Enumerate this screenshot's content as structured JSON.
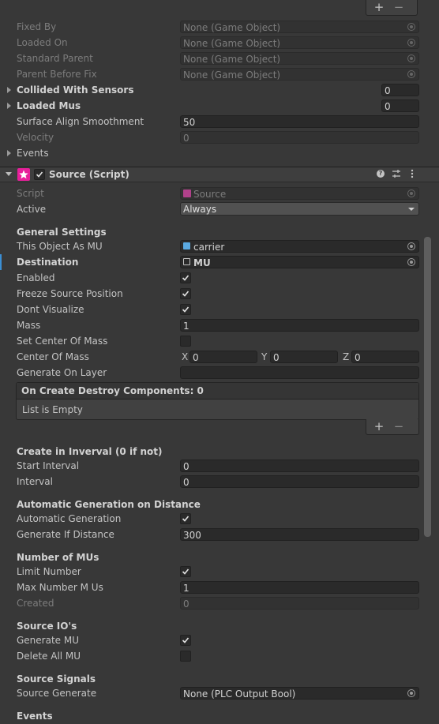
{
  "top_refs": [
    {
      "label": "Fixed By",
      "value": "None (Game Object)"
    },
    {
      "label": "Loaded On",
      "value": "None (Game Object)"
    },
    {
      "label": "Standard Parent",
      "value": "None (Game Object)"
    },
    {
      "label": "Parent Before Fix",
      "value": "None (Game Object)"
    }
  ],
  "collided_with_sensors": {
    "label": "Collided With Sensors",
    "value": "0"
  },
  "loaded_mus": {
    "label": "Loaded Mus",
    "value": "0"
  },
  "surface_align": {
    "label": "Surface Align Smoothment",
    "value": "50"
  },
  "velocity": {
    "label": "Velocity",
    "value": "0"
  },
  "events_top": {
    "label": "Events"
  },
  "component": {
    "title": "Source (Script)"
  },
  "script_row": {
    "label": "Script",
    "value": "Source"
  },
  "active_row": {
    "label": "Active",
    "value": "Always"
  },
  "general": {
    "heading": "General Settings",
    "this_object": {
      "label": "This Object As MU",
      "value": "carrier"
    },
    "destination": {
      "label": "Destination",
      "value": "MU"
    },
    "enabled": {
      "label": "Enabled"
    },
    "freeze": {
      "label": "Freeze Source Position"
    },
    "dont_visualize": {
      "label": "Dont Visualize"
    },
    "mass": {
      "label": "Mass",
      "value": "1"
    },
    "set_com": {
      "label": "Set Center Of Mass"
    },
    "com": {
      "label": "Center Of Mass",
      "x": "0",
      "y": "0",
      "z": "0",
      "xl": "X",
      "yl": "Y",
      "zl": "Z"
    },
    "gen_layer": {
      "label": "Generate On Layer",
      "value": ""
    },
    "destroy_list": {
      "title": "On Create Destroy Components: 0",
      "empty": "List is Empty"
    }
  },
  "interval": {
    "heading": "Create in Inverval (0 if not)",
    "start": {
      "label": "Start Interval",
      "value": "0"
    },
    "interval": {
      "label": "Interval",
      "value": "0"
    }
  },
  "distance": {
    "heading": "Automatic Generation on Distance",
    "auto": {
      "label": "Automatic Generation"
    },
    "gen_if": {
      "label": "Generate If Distance",
      "value": "300"
    }
  },
  "number": {
    "heading": "Number of MUs",
    "limit": {
      "label": "Limit Number"
    },
    "max": {
      "label": "Max Number M Us",
      "value": "1"
    },
    "created": {
      "label": "Created",
      "value": "0"
    }
  },
  "ios": {
    "heading": "Source IO's",
    "gen_mu": {
      "label": "Generate MU"
    },
    "del_all": {
      "label": "Delete All MU"
    }
  },
  "signals": {
    "heading": "Source Signals",
    "source_gen": {
      "label": "Source Generate",
      "value": "None (PLC Output Bool)"
    }
  },
  "events_bottom": {
    "label": "Events"
  },
  "buttons": {
    "plus": "+",
    "minus": "−"
  },
  "colors": {
    "accent": "#3b8fd4",
    "script_icon": "#e81f9b"
  }
}
